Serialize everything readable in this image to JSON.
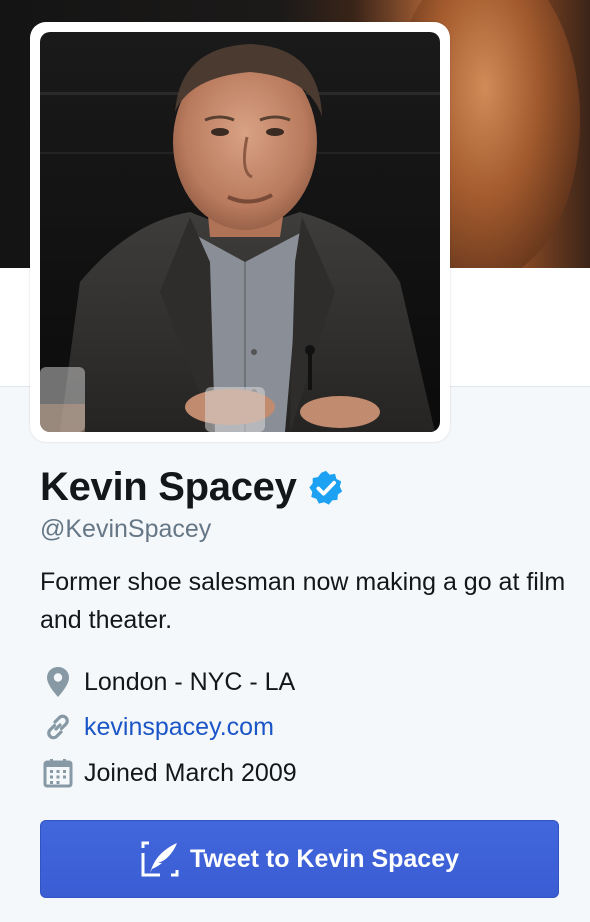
{
  "profile": {
    "name": "Kevin Spacey",
    "handle": "@KevinSpacey",
    "verified": true,
    "bio": "Former shoe salesman now making a go at film and theater.",
    "location": "London - NYC - LA",
    "url": "kevinspacey.com",
    "joined": "Joined March 2009"
  },
  "actions": {
    "tweet_to_label": "Tweet to Kevin Spacey"
  },
  "icons": {
    "verified": "verified-badge-icon",
    "location": "location-pin-icon",
    "url": "link-icon",
    "joined": "calendar-icon",
    "tweet": "compose-quill-icon"
  },
  "colors": {
    "background": "#f5f8fa",
    "text": "#14171a",
    "secondary": "#657786",
    "link": "#1b55c7",
    "verified": "#1da1f2",
    "button": "#3b5fd6"
  }
}
